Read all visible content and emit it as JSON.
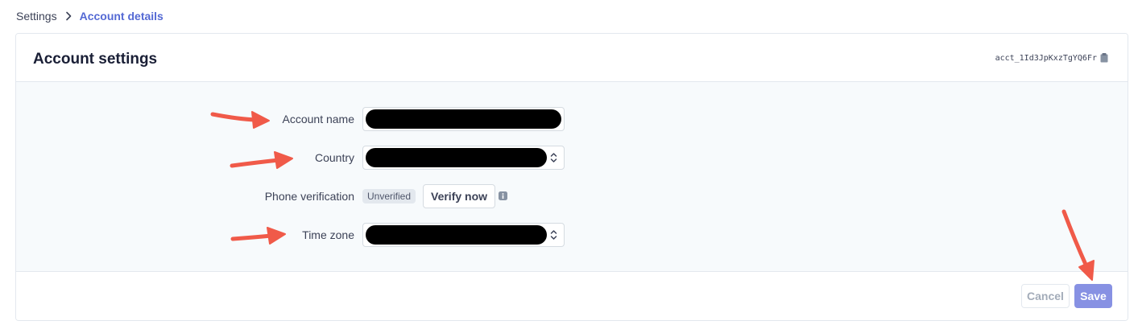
{
  "breadcrumb": {
    "root": "Settings",
    "current": "Account details"
  },
  "card": {
    "title": "Account settings",
    "account_id": "acct_1Id3JpKxzTgYQ6Fr"
  },
  "form": {
    "account_name": {
      "label": "Account name",
      "value": "[redacted]"
    },
    "country": {
      "label": "Country",
      "value": "[redacted]"
    },
    "phone_verification": {
      "label": "Phone verification",
      "status": "Unverified",
      "action": "Verify now"
    },
    "time_zone": {
      "label": "Time zone",
      "value": "[redacted]"
    }
  },
  "footer": {
    "cancel_label": "Cancel",
    "save_label": "Save"
  },
  "colors": {
    "accent": "#5469d4",
    "save_button": "#8791e3",
    "annotation_arrow": "#f05a49",
    "body_bg": "#f7fafc"
  },
  "icons": {
    "breadcrumb_separator": "chevron-right-icon",
    "copy": "clipboard-icon",
    "select": "chevron-up-down-icon",
    "info": "info-icon"
  }
}
